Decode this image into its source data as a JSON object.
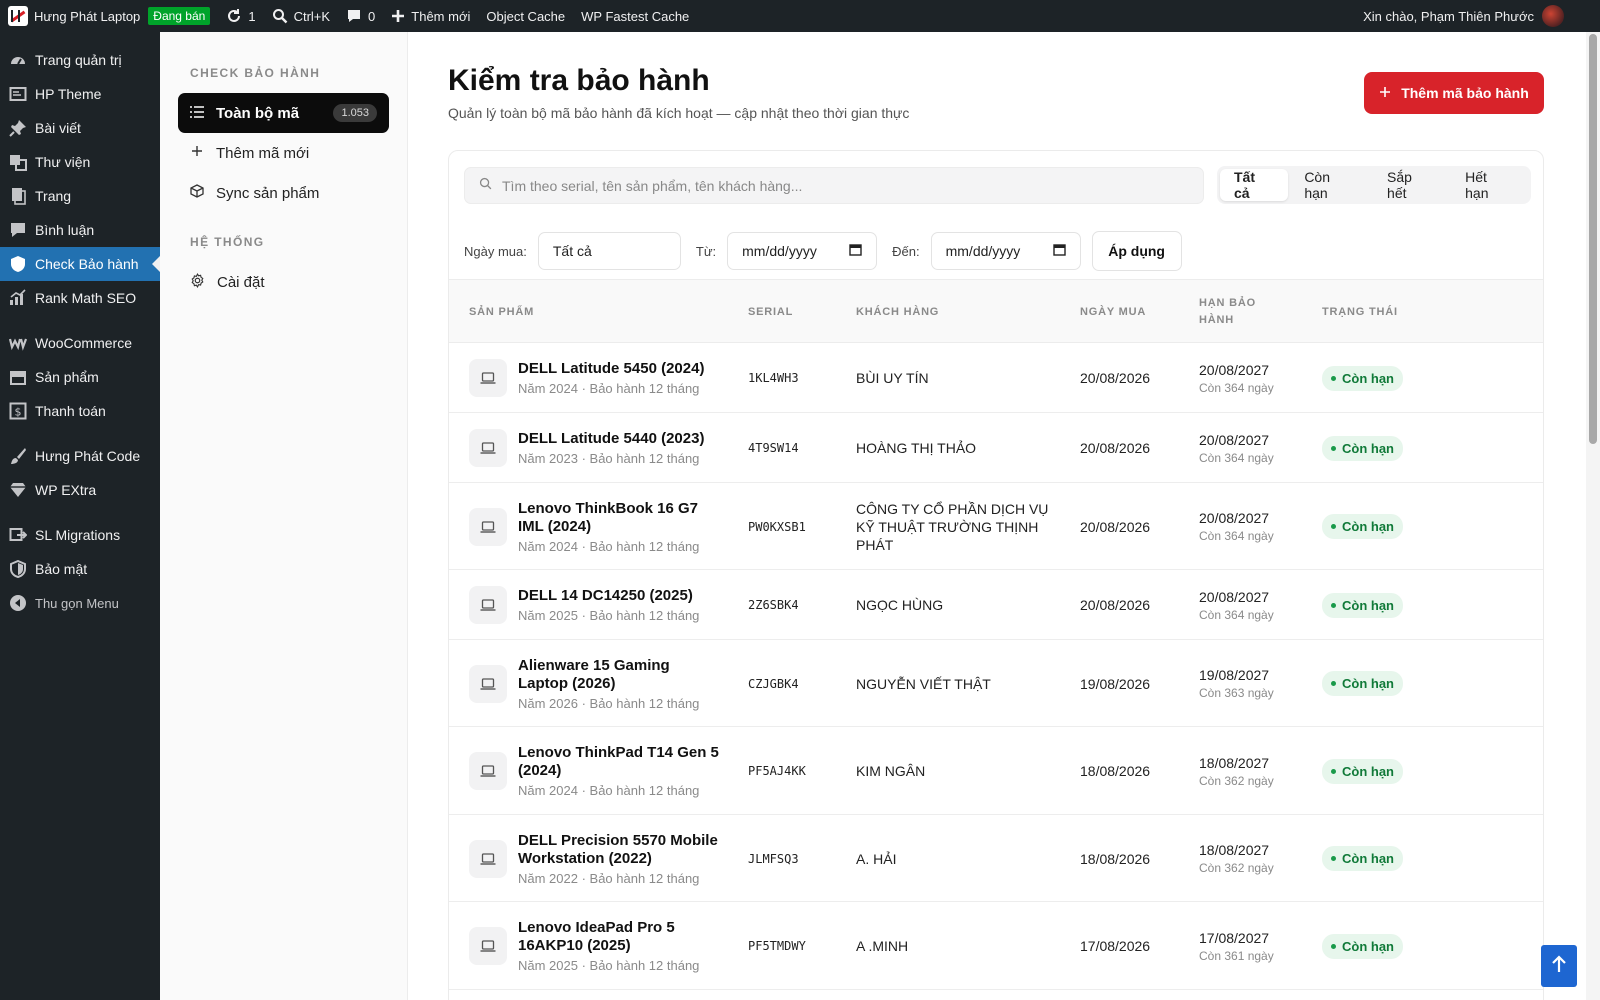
{
  "adminbar": {
    "site_name": "Hưng Phát Laptop",
    "status_badge": "Đang bán",
    "updates_count": "1",
    "search_shortcut": "Ctrl+K",
    "comments_count": "0",
    "new_label": "Thêm mới",
    "object_cache": "Object Cache",
    "fastest_cache": "WP Fastest Cache",
    "greeting": "Xin chào, Phạm Thiên Phước"
  },
  "wpmenu": {
    "items": [
      {
        "label": "Trang quản trị",
        "icon": "dashboard-icon"
      },
      {
        "label": "HP Theme",
        "icon": "theme-icon"
      },
      {
        "label": "Bài viết",
        "icon": "pin-icon"
      },
      {
        "label": "Thư viện",
        "icon": "media-icon"
      },
      {
        "label": "Trang",
        "icon": "page-icon"
      },
      {
        "label": "Bình luận",
        "icon": "comment-icon"
      },
      {
        "label": "Check Bảo hành",
        "icon": "shield-icon"
      },
      {
        "label": "Rank Math SEO",
        "icon": "chart-icon"
      },
      {
        "label": "WooCommerce",
        "icon": "woo-icon"
      },
      {
        "label": "Sản phẩm",
        "icon": "archive-icon"
      },
      {
        "label": "Thanh toán",
        "icon": "money-icon"
      },
      {
        "label": "Hưng Phát Code",
        "icon": "brush-icon"
      },
      {
        "label": "WP EXtra",
        "icon": "diamond-icon"
      },
      {
        "label": "SL Migrations",
        "icon": "migrate-icon"
      },
      {
        "label": "Bảo mật",
        "icon": "security-icon"
      }
    ],
    "collapse_label": "Thu gọn Menu"
  },
  "subnav": {
    "section1": "CHECK BẢO HÀNH",
    "all_codes": "Toàn bộ mã",
    "all_count": "1.053",
    "add_new": "Thêm mã mới",
    "sync": "Sync sản phẩm",
    "section2": "HỆ THỐNG",
    "settings": "Cài đặt"
  },
  "main": {
    "title": "Kiểm tra bảo hành",
    "subtitle": "Quản lý toàn bộ mã bảo hành đã kích hoạt — cập nhật theo thời gian thực",
    "add_button": "Thêm mã bảo hành",
    "search_placeholder": "Tìm theo serial, tên sản phẩm, tên khách hàng...",
    "tabs": [
      "Tất cả",
      "Còn hạn",
      "Sắp hết",
      "Hết hạn"
    ],
    "filter_purchase_label": "Ngày mua:",
    "filter_purchase_value": "Tất cả",
    "from_label": "Từ:",
    "to_label": "Đến:",
    "date_placeholder": "mm/dd/yyyy",
    "apply": "Áp dụng"
  },
  "table": {
    "headers": {
      "product": "SẢN PHẨM",
      "serial": "SERIAL",
      "customer": "KHÁCH HÀNG",
      "purchase": "NGÀY MUA",
      "expiry_line1": "HẠN BẢO",
      "expiry_line2": "HÀNH",
      "status": "TRẠNG THÁI"
    },
    "rows": [
      {
        "name": [
          "DELL Latitude 5450 (2024)"
        ],
        "meta": "Năm 2024 · Bảo hành 12 tháng",
        "serial": "1KL4WH3",
        "customer": [
          "BÙI UY TÍN"
        ],
        "purchase": "20/08/2026",
        "expiry": "20/08/2027",
        "remaining": "Còn 364 ngày",
        "status": "Còn hạn"
      },
      {
        "name": [
          "DELL Latitude 5440 (2023)"
        ],
        "meta": "Năm 2023 · Bảo hành 12 tháng",
        "serial": "4T9SW14",
        "customer": [
          "HOÀNG THỊ THẢO"
        ],
        "purchase": "20/08/2026",
        "expiry": "20/08/2027",
        "remaining": "Còn 364 ngày",
        "status": "Còn hạn"
      },
      {
        "name": [
          "Lenovo ThinkBook 16 G7",
          "IML (2024)"
        ],
        "meta": "Năm 2024 · Bảo hành 12 tháng",
        "serial": "PW0KXSB1",
        "customer": [
          "CÔNG TY CỔ PHẦN DỊCH VỤ",
          "KỸ THUẬT TRƯỜNG THỊNH",
          "PHÁT"
        ],
        "purchase": "20/08/2026",
        "expiry": "20/08/2027",
        "remaining": "Còn 364 ngày",
        "status": "Còn hạn"
      },
      {
        "name": [
          "DELL 14 DC14250 (2025)"
        ],
        "meta": "Năm 2025 · Bảo hành 12 tháng",
        "serial": "2Z6SBK4",
        "customer": [
          "NGỌC HÙNG"
        ],
        "purchase": "20/08/2026",
        "expiry": "20/08/2027",
        "remaining": "Còn 364 ngày",
        "status": "Còn hạn"
      },
      {
        "name": [
          "Alienware 15 Gaming",
          "Laptop (2026)"
        ],
        "meta": "Năm 2026 · Bảo hành 12 tháng",
        "serial": "CZJGBK4",
        "customer": [
          "NGUYỄN VIẾT THẬT"
        ],
        "purchase": "19/08/2026",
        "expiry": "19/08/2027",
        "remaining": "Còn 363 ngày",
        "status": "Còn hạn"
      },
      {
        "name": [
          "Lenovo ThinkPad T14 Gen 5",
          "(2024)"
        ],
        "meta": "Năm 2024 · Bảo hành 12 tháng",
        "serial": "PF5AJ4KK",
        "customer": [
          "KIM NGÂN"
        ],
        "purchase": "18/08/2026",
        "expiry": "18/08/2027",
        "remaining": "Còn 362 ngày",
        "status": "Còn hạn"
      },
      {
        "name": [
          "DELL Precision 5570 Mobile",
          "Workstation (2022)"
        ],
        "meta": "Năm 2022 · Bảo hành 12 tháng",
        "serial": "JLMFSQ3",
        "customer": [
          "A. HẢI"
        ],
        "purchase": "18/08/2026",
        "expiry": "18/08/2027",
        "remaining": "Còn 362 ngày",
        "status": "Còn hạn"
      },
      {
        "name": [
          "Lenovo IdeaPad Pro 5",
          "16AKP10 (2025)"
        ],
        "meta": "Năm 2025 · Bảo hành 12 tháng",
        "serial": "PF5TMDWY",
        "customer": [
          "A .MINH"
        ],
        "purchase": "17/08/2026",
        "expiry": "17/08/2027",
        "remaining": "Còn 361 ngày",
        "status": "Còn hạn"
      }
    ]
  },
  "colors": {
    "accent_red": "#d8232a",
    "wp_dark": "#1d2327",
    "wp_blue": "#2271b1",
    "status_green": "#117a39"
  }
}
